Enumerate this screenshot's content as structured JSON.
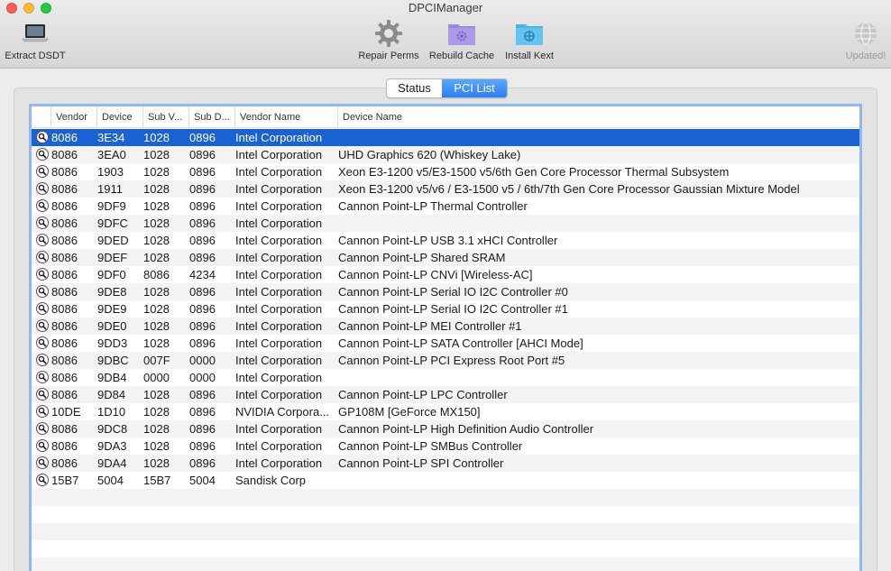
{
  "window": {
    "title": "DPCIManager"
  },
  "toolbar": {
    "extract": {
      "label": "Extract DSDT",
      "icon": "laptop-icon"
    },
    "repair": {
      "label": "Repair Perms",
      "icon": "gear-icon"
    },
    "rebuild": {
      "label": "Rebuild Cache",
      "icon": "folder-gear-icon"
    },
    "kext": {
      "label": "Install Kext",
      "icon": "folder-kext-icon"
    },
    "update": {
      "label": "Updated!",
      "icon": "globe-icon"
    }
  },
  "tabs": {
    "status": "Status",
    "pci_list": "PCI List",
    "active": "PCI List"
  },
  "table": {
    "headers": {
      "vendor": "Vendor",
      "device": "Device",
      "subv": "Sub V...",
      "subd": "Sub D...",
      "vname": "Vendor Name",
      "dname": "Device Name"
    },
    "selected_index": 0,
    "rows": [
      {
        "vendor": "8086",
        "device": "3E34",
        "subv": "1028",
        "subd": "0896",
        "vname": "Intel Corporation",
        "dname": ""
      },
      {
        "vendor": "8086",
        "device": "3EA0",
        "subv": "1028",
        "subd": "0896",
        "vname": "Intel Corporation",
        "dname": "UHD Graphics 620 (Whiskey Lake)"
      },
      {
        "vendor": "8086",
        "device": "1903",
        "subv": "1028",
        "subd": "0896",
        "vname": "Intel Corporation",
        "dname": "Xeon E3-1200 v5/E3-1500 v5/6th Gen Core Processor Thermal Subsystem"
      },
      {
        "vendor": "8086",
        "device": "1911",
        "subv": "1028",
        "subd": "0896",
        "vname": "Intel Corporation",
        "dname": "Xeon E3-1200 v5/v6 / E3-1500 v5 / 6th/7th Gen Core Processor Gaussian Mixture Model"
      },
      {
        "vendor": "8086",
        "device": "9DF9",
        "subv": "1028",
        "subd": "0896",
        "vname": "Intel Corporation",
        "dname": "Cannon Point-LP Thermal Controller"
      },
      {
        "vendor": "8086",
        "device": "9DFC",
        "subv": "1028",
        "subd": "0896",
        "vname": "Intel Corporation",
        "dname": ""
      },
      {
        "vendor": "8086",
        "device": "9DED",
        "subv": "1028",
        "subd": "0896",
        "vname": "Intel Corporation",
        "dname": "Cannon Point-LP USB 3.1 xHCI Controller"
      },
      {
        "vendor": "8086",
        "device": "9DEF",
        "subv": "1028",
        "subd": "0896",
        "vname": "Intel Corporation",
        "dname": "Cannon Point-LP Shared SRAM"
      },
      {
        "vendor": "8086",
        "device": "9DF0",
        "subv": "8086",
        "subd": "4234",
        "vname": "Intel Corporation",
        "dname": "Cannon Point-LP CNVi [Wireless-AC]"
      },
      {
        "vendor": "8086",
        "device": "9DE8",
        "subv": "1028",
        "subd": "0896",
        "vname": "Intel Corporation",
        "dname": "Cannon Point-LP Serial IO I2C Controller #0"
      },
      {
        "vendor": "8086",
        "device": "9DE9",
        "subv": "1028",
        "subd": "0896",
        "vname": "Intel Corporation",
        "dname": "Cannon Point-LP Serial IO I2C Controller #1"
      },
      {
        "vendor": "8086",
        "device": "9DE0",
        "subv": "1028",
        "subd": "0896",
        "vname": "Intel Corporation",
        "dname": "Cannon Point-LP MEI Controller #1"
      },
      {
        "vendor": "8086",
        "device": "9DD3",
        "subv": "1028",
        "subd": "0896",
        "vname": "Intel Corporation",
        "dname": "Cannon Point-LP SATA Controller [AHCI Mode]"
      },
      {
        "vendor": "8086",
        "device": "9DBC",
        "subv": "007F",
        "subd": "0000",
        "vname": "Intel Corporation",
        "dname": "Cannon Point-LP PCI Express Root Port #5"
      },
      {
        "vendor": "8086",
        "device": "9DB4",
        "subv": "0000",
        "subd": "0000",
        "vname": "Intel Corporation",
        "dname": ""
      },
      {
        "vendor": "8086",
        "device": "9D84",
        "subv": "1028",
        "subd": "0896",
        "vname": "Intel Corporation",
        "dname": "Cannon Point-LP LPC Controller"
      },
      {
        "vendor": "10DE",
        "device": "1D10",
        "subv": "1028",
        "subd": "0896",
        "vname": "NVIDIA Corpora...",
        "dname": "GP108M [GeForce MX150]"
      },
      {
        "vendor": "8086",
        "device": "9DC8",
        "subv": "1028",
        "subd": "0896",
        "vname": "Intel Corporation",
        "dname": "Cannon Point-LP High Definition Audio Controller"
      },
      {
        "vendor": "8086",
        "device": "9DA3",
        "subv": "1028",
        "subd": "0896",
        "vname": "Intel Corporation",
        "dname": "Cannon Point-LP SMBus Controller"
      },
      {
        "vendor": "8086",
        "device": "9DA4",
        "subv": "1028",
        "subd": "0896",
        "vname": "Intel Corporation",
        "dname": "Cannon Point-LP SPI Controller"
      },
      {
        "vendor": "15B7",
        "device": "5004",
        "subv": "15B7",
        "subd": "5004",
        "vname": "Sandisk Corp",
        "dname": ""
      }
    ]
  },
  "colors": {
    "selection": "#1a62d3",
    "focus_ring": "#8fb8ef",
    "tab_active": "#2d7ff0"
  }
}
